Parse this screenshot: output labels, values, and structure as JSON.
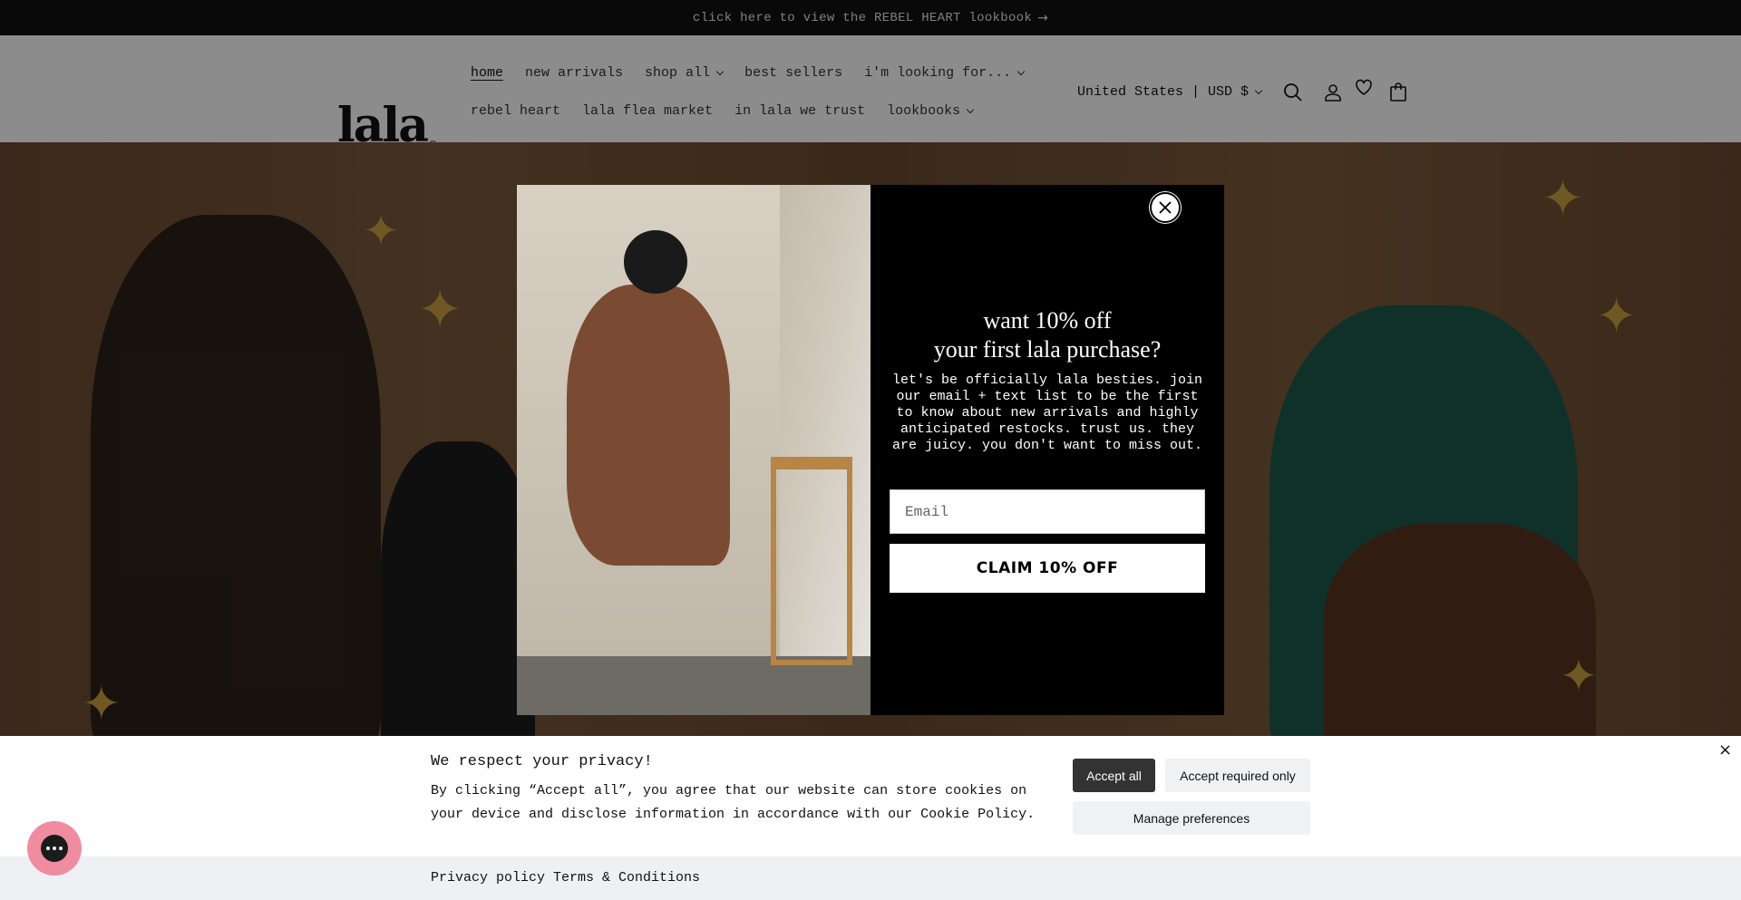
{
  "announcement": {
    "text": "click here to view the REBEL HEART lookbook",
    "arrow": "→"
  },
  "header": {
    "logo": "lala",
    "logo_mark": "©",
    "nav_row1": [
      {
        "label": "home",
        "dropdown": false,
        "active": true
      },
      {
        "label": "new arrivals",
        "dropdown": false
      },
      {
        "label": "shop all",
        "dropdown": true
      },
      {
        "label": "best sellers",
        "dropdown": false
      },
      {
        "label": "i'm looking for...",
        "dropdown": true
      }
    ],
    "nav_row2": [
      {
        "label": "rebel heart",
        "dropdown": false
      },
      {
        "label": "lala flea market",
        "dropdown": false
      },
      {
        "label": "in lala we trust",
        "dropdown": false
      },
      {
        "label": "lookbooks",
        "dropdown": true
      }
    ],
    "country_selector": "United States | USD $",
    "icons": [
      "search-icon",
      "account-icon",
      "wishlist-heart-icon",
      "cart-icon"
    ]
  },
  "popup": {
    "title_line1": "want 10% off",
    "title_line2": "your first lala purchase?",
    "body": "let's be officially lala besties. join our email + text list to be the first to know about new arrivals and highly anticipated restocks. trust us. they are juicy. you don't want to miss out.",
    "email_placeholder": "Email",
    "cta_label": "CLAIM 10% OFF",
    "close_icon": "close-icon"
  },
  "cookie_banner": {
    "title": "We respect your privacy!",
    "text": "By clicking “Accept all”, you agree that our website can store cookies on your device and disclose information in accordance with our Cookie Policy.",
    "accept_all": "Accept all",
    "accept_required": "Accept required only",
    "manage": "Manage preferences",
    "close": "×",
    "links": [
      "Privacy policy",
      "Terms & Conditions"
    ]
  },
  "colors": {
    "announcement_bg": "#121212",
    "popup_bg": "#000000",
    "cta_bg": "#ffffff",
    "accept_all_bg": "#333333",
    "secondary_btn_bg": "#eff1f2",
    "chat_bubble": "#f08ca0"
  },
  "chat_widget": {
    "icon": "chat-icon"
  }
}
